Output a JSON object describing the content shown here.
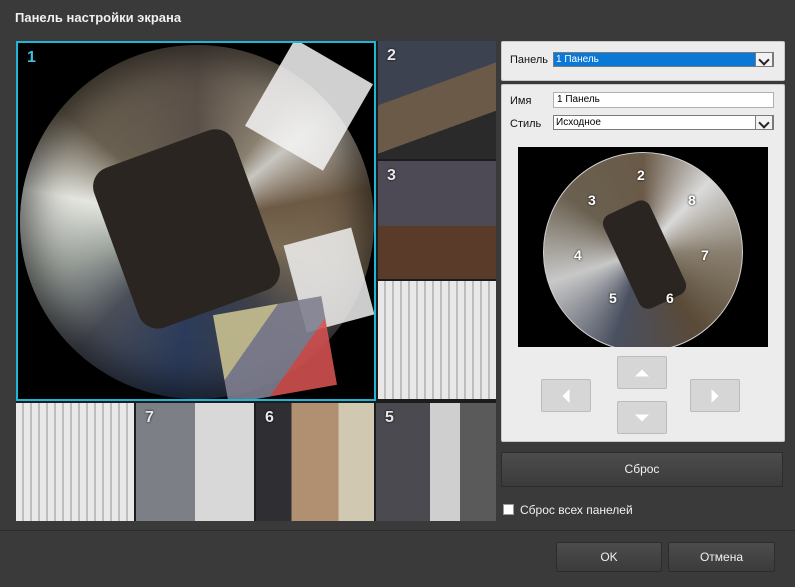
{
  "window": {
    "title": "Панель настройки экрана"
  },
  "grid": {
    "cells": [
      {
        "num": "1"
      },
      {
        "num": "2"
      },
      {
        "num": "3"
      },
      {
        "num": ""
      },
      {
        "num": ""
      },
      {
        "num": "7"
      },
      {
        "num": "6"
      },
      {
        "num": "5"
      }
    ]
  },
  "panel": {
    "panel_label": "Панель",
    "panel_value": "1 Панель",
    "name_label": "Имя",
    "name_value": "1 Панель",
    "style_label": "Стиль",
    "style_value": "Исходное",
    "preview_labels": [
      "2",
      "3",
      "8",
      "4",
      "7",
      "5",
      "6"
    ]
  },
  "buttons": {
    "reset": "Сброс",
    "reset_all_label": "Сброс всех панелей",
    "ok": "OK",
    "cancel": "Отмена"
  },
  "colors": {
    "selection": "#20b4d8",
    "combo_highlight": "#0a78d7"
  }
}
